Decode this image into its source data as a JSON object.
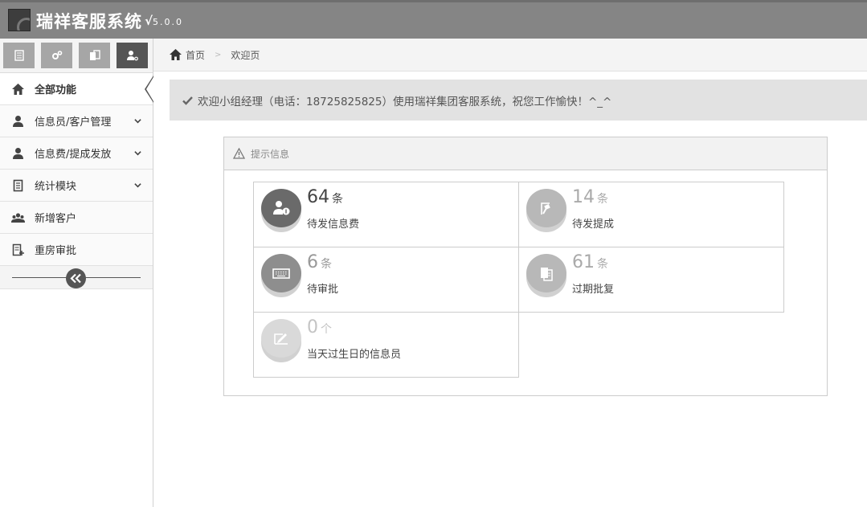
{
  "header": {
    "title": "瑞祥客服系统",
    "version_mark": "√",
    "version": "5.0.0"
  },
  "shortcuts": [
    {
      "icon": "list-icon"
    },
    {
      "icon": "gears-icon"
    },
    {
      "icon": "documents-icon"
    },
    {
      "icon": "user-key-icon"
    }
  ],
  "sidebar": {
    "items": [
      {
        "label": "全部功能",
        "icon": "home-icon",
        "active": true
      },
      {
        "label": "信息员/客户管理",
        "icon": "user-icon",
        "expandable": true
      },
      {
        "label": "信息费/提成发放",
        "icon": "user-icon",
        "expandable": true
      },
      {
        "label": "统计模块",
        "icon": "document-icon",
        "expandable": true
      },
      {
        "label": "新增客户",
        "icon": "group-icon"
      },
      {
        "label": "重房审批",
        "icon": "edit-document-icon"
      }
    ]
  },
  "breadcrumb": {
    "home": "首页",
    "separator": ">",
    "current": "欢迎页"
  },
  "welcome": {
    "message": "欢迎小组经理（电话：18725825825）使用瑞祥集团客服系统，祝您工作愉快！^_^"
  },
  "panel": {
    "title": "提示信息",
    "stats": [
      {
        "count": "64",
        "unit": "条",
        "label": "待发信息费",
        "icon": "user-money-icon"
      },
      {
        "count": "14",
        "unit": "条",
        "label": "待发提成",
        "icon": "hammer-icon"
      },
      {
        "count": "6",
        "unit": "条",
        "label": "待审批",
        "icon": "keyboard-icon"
      },
      {
        "count": "61",
        "unit": "条",
        "label": "过期批复",
        "icon": "copy-icon"
      },
      {
        "count": "0",
        "unit": "个",
        "label": "当天过生日的信息员",
        "icon": "sign-icon"
      }
    ]
  },
  "colors": {
    "header_bg": "#858585",
    "accent_dark": "#555555"
  }
}
